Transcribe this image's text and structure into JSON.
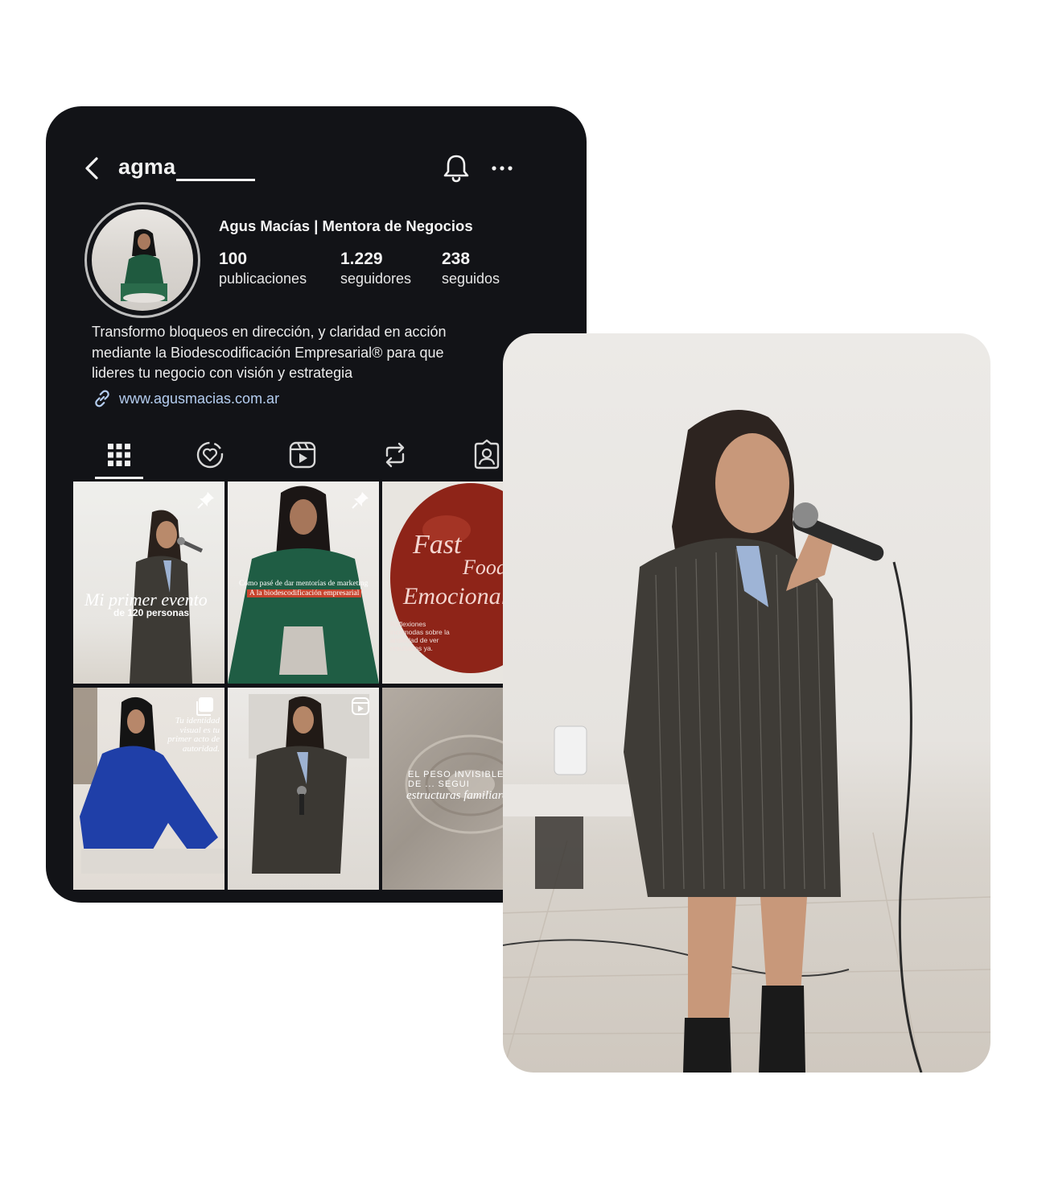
{
  "profile": {
    "username": "agma",
    "full_name": "Agus Macías | Mentora de Negocios",
    "stats": [
      {
        "value": "100",
        "label": "publicaciones"
      },
      {
        "value": "1.229",
        "label": "seguidores"
      },
      {
        "value": "238",
        "label": "seguidos"
      }
    ],
    "bio_lines": [
      "Transformo bloqueos en dirección, y claridad en acción",
      "mediante la Biodescodificación Empresarial® para que",
      "lideres tu negocio con visión y estrategia"
    ],
    "link": "www.agusmacias.com.ar"
  },
  "icons": {
    "back": "chevron-left-icon",
    "notifications": "bell-icon",
    "more": "ellipsis-icon",
    "link": "link-icon"
  },
  "tabs": [
    {
      "name": "grid",
      "icon": "grid-icon",
      "active": true
    },
    {
      "name": "highlights",
      "icon": "heart-circle-icon",
      "active": false
    },
    {
      "name": "reels",
      "icon": "reels-icon",
      "active": false
    },
    {
      "name": "reposts",
      "icon": "repost-icon",
      "active": false
    },
    {
      "name": "tagged",
      "icon": "tagged-icon",
      "active": false
    }
  ],
  "posts": [
    {
      "overlay_title": "Mi primer evento",
      "overlay_sub": "de 120 personas",
      "badge": "pin"
    },
    {
      "overlay_title": "Cómo pasé de dar mentorías de marketing",
      "overlay_sub": "A la biodescodificación empresarial",
      "badge": "pin"
    },
    {
      "overlay_title": "Fast",
      "overlay_title2": "Food",
      "overlay_title3": "Emocional",
      "overlay_sub": "Reflexiones incómodas sobre la ansiedad de ver resultados ya.",
      "badge": ""
    },
    {
      "overlay_title": "Tu identidad visual es tu primer acto de autoridad.",
      "overlay_sub": "",
      "badge": "carousel"
    },
    {
      "overlay_title": "",
      "overlay_sub": "",
      "badge": "reel"
    },
    {
      "overlay_title": "EL PESO INVISIBLE",
      "overlay_title2": "DE ... SEGUI",
      "overlay_sub": "estructuras familiares",
      "badge": ""
    }
  ],
  "colors": {
    "background": "#ffffff",
    "card": "#121317",
    "text": "#f5f5f5",
    "link": "#b4cdf0"
  }
}
